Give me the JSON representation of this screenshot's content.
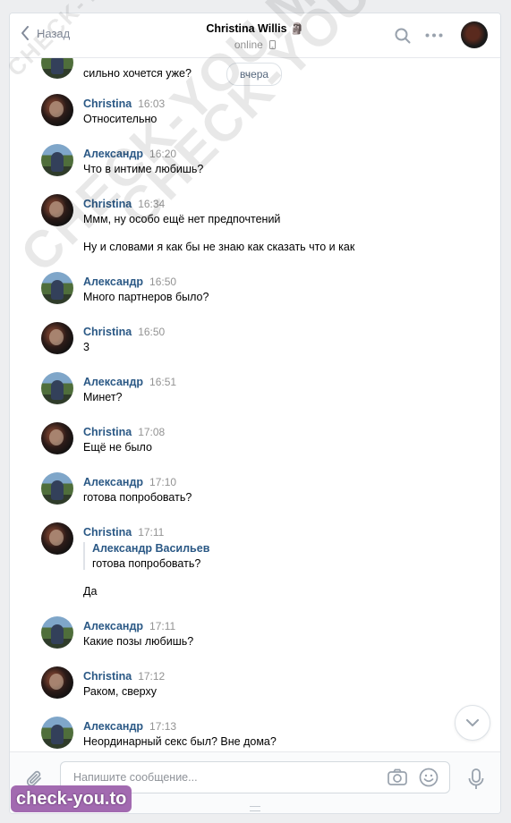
{
  "header": {
    "back_label": "Назад",
    "title": "Christina Willis 🗿",
    "status": "online",
    "icons": [
      "chevron-left-icon",
      "search-icon",
      "more-icon",
      "phone-icon"
    ]
  },
  "date_pill": "вчера",
  "messages": [
    {
      "author": "",
      "time": "",
      "lines": [
        "сильно хочется уже?"
      ]
    },
    {
      "author": "Christina",
      "time": "16:03",
      "lines": [
        "Относительно"
      ]
    },
    {
      "author": "Александр",
      "time": "16:20",
      "lines": [
        "Что в интиме любишь?"
      ]
    },
    {
      "author": "Christina",
      "time": "16:34",
      "lines": [
        "Ммм, ну особо ещё нет предпочтений",
        "Ну и словами я как бы не знаю как сказать что и как"
      ]
    },
    {
      "author": "Александр",
      "time": "16:50",
      "lines": [
        "Много партнеров было?"
      ]
    },
    {
      "author": "Christina",
      "time": "16:50",
      "lines": [
        "3"
      ]
    },
    {
      "author": "Александр",
      "time": "16:51",
      "lines": [
        "Минет?"
      ]
    },
    {
      "author": "Christina",
      "time": "17:08",
      "lines": [
        "Ещё не было"
      ]
    },
    {
      "author": "Александр",
      "time": "17:10",
      "lines": [
        "готова попробовать?"
      ]
    },
    {
      "author": "Christina",
      "time": "17:11",
      "quote": {
        "author": "Александр Васильев",
        "text": "готова попробовать?"
      },
      "lines": [
        "Да"
      ]
    },
    {
      "author": "Александр",
      "time": "17:11",
      "lines": [
        "Какие позы любишь?"
      ]
    },
    {
      "author": "Christina",
      "time": "17:12",
      "lines": [
        "Раком, сверху"
      ]
    },
    {
      "author": "Александр",
      "time": "17:13",
      "lines": [
        "Неординарный секс был? Вне дома?"
      ]
    }
  ],
  "composer": {
    "placeholder": "Напишите сообщение..."
  },
  "watermarks": [
    "CHECK-YOU.ME",
    "CHECK-YOU.ME",
    "CHECK-YOU.ME"
  ],
  "badge": "check-you.to",
  "colors": {
    "link": "#2a5885",
    "muted": "#939393",
    "background": "#edeef0"
  }
}
